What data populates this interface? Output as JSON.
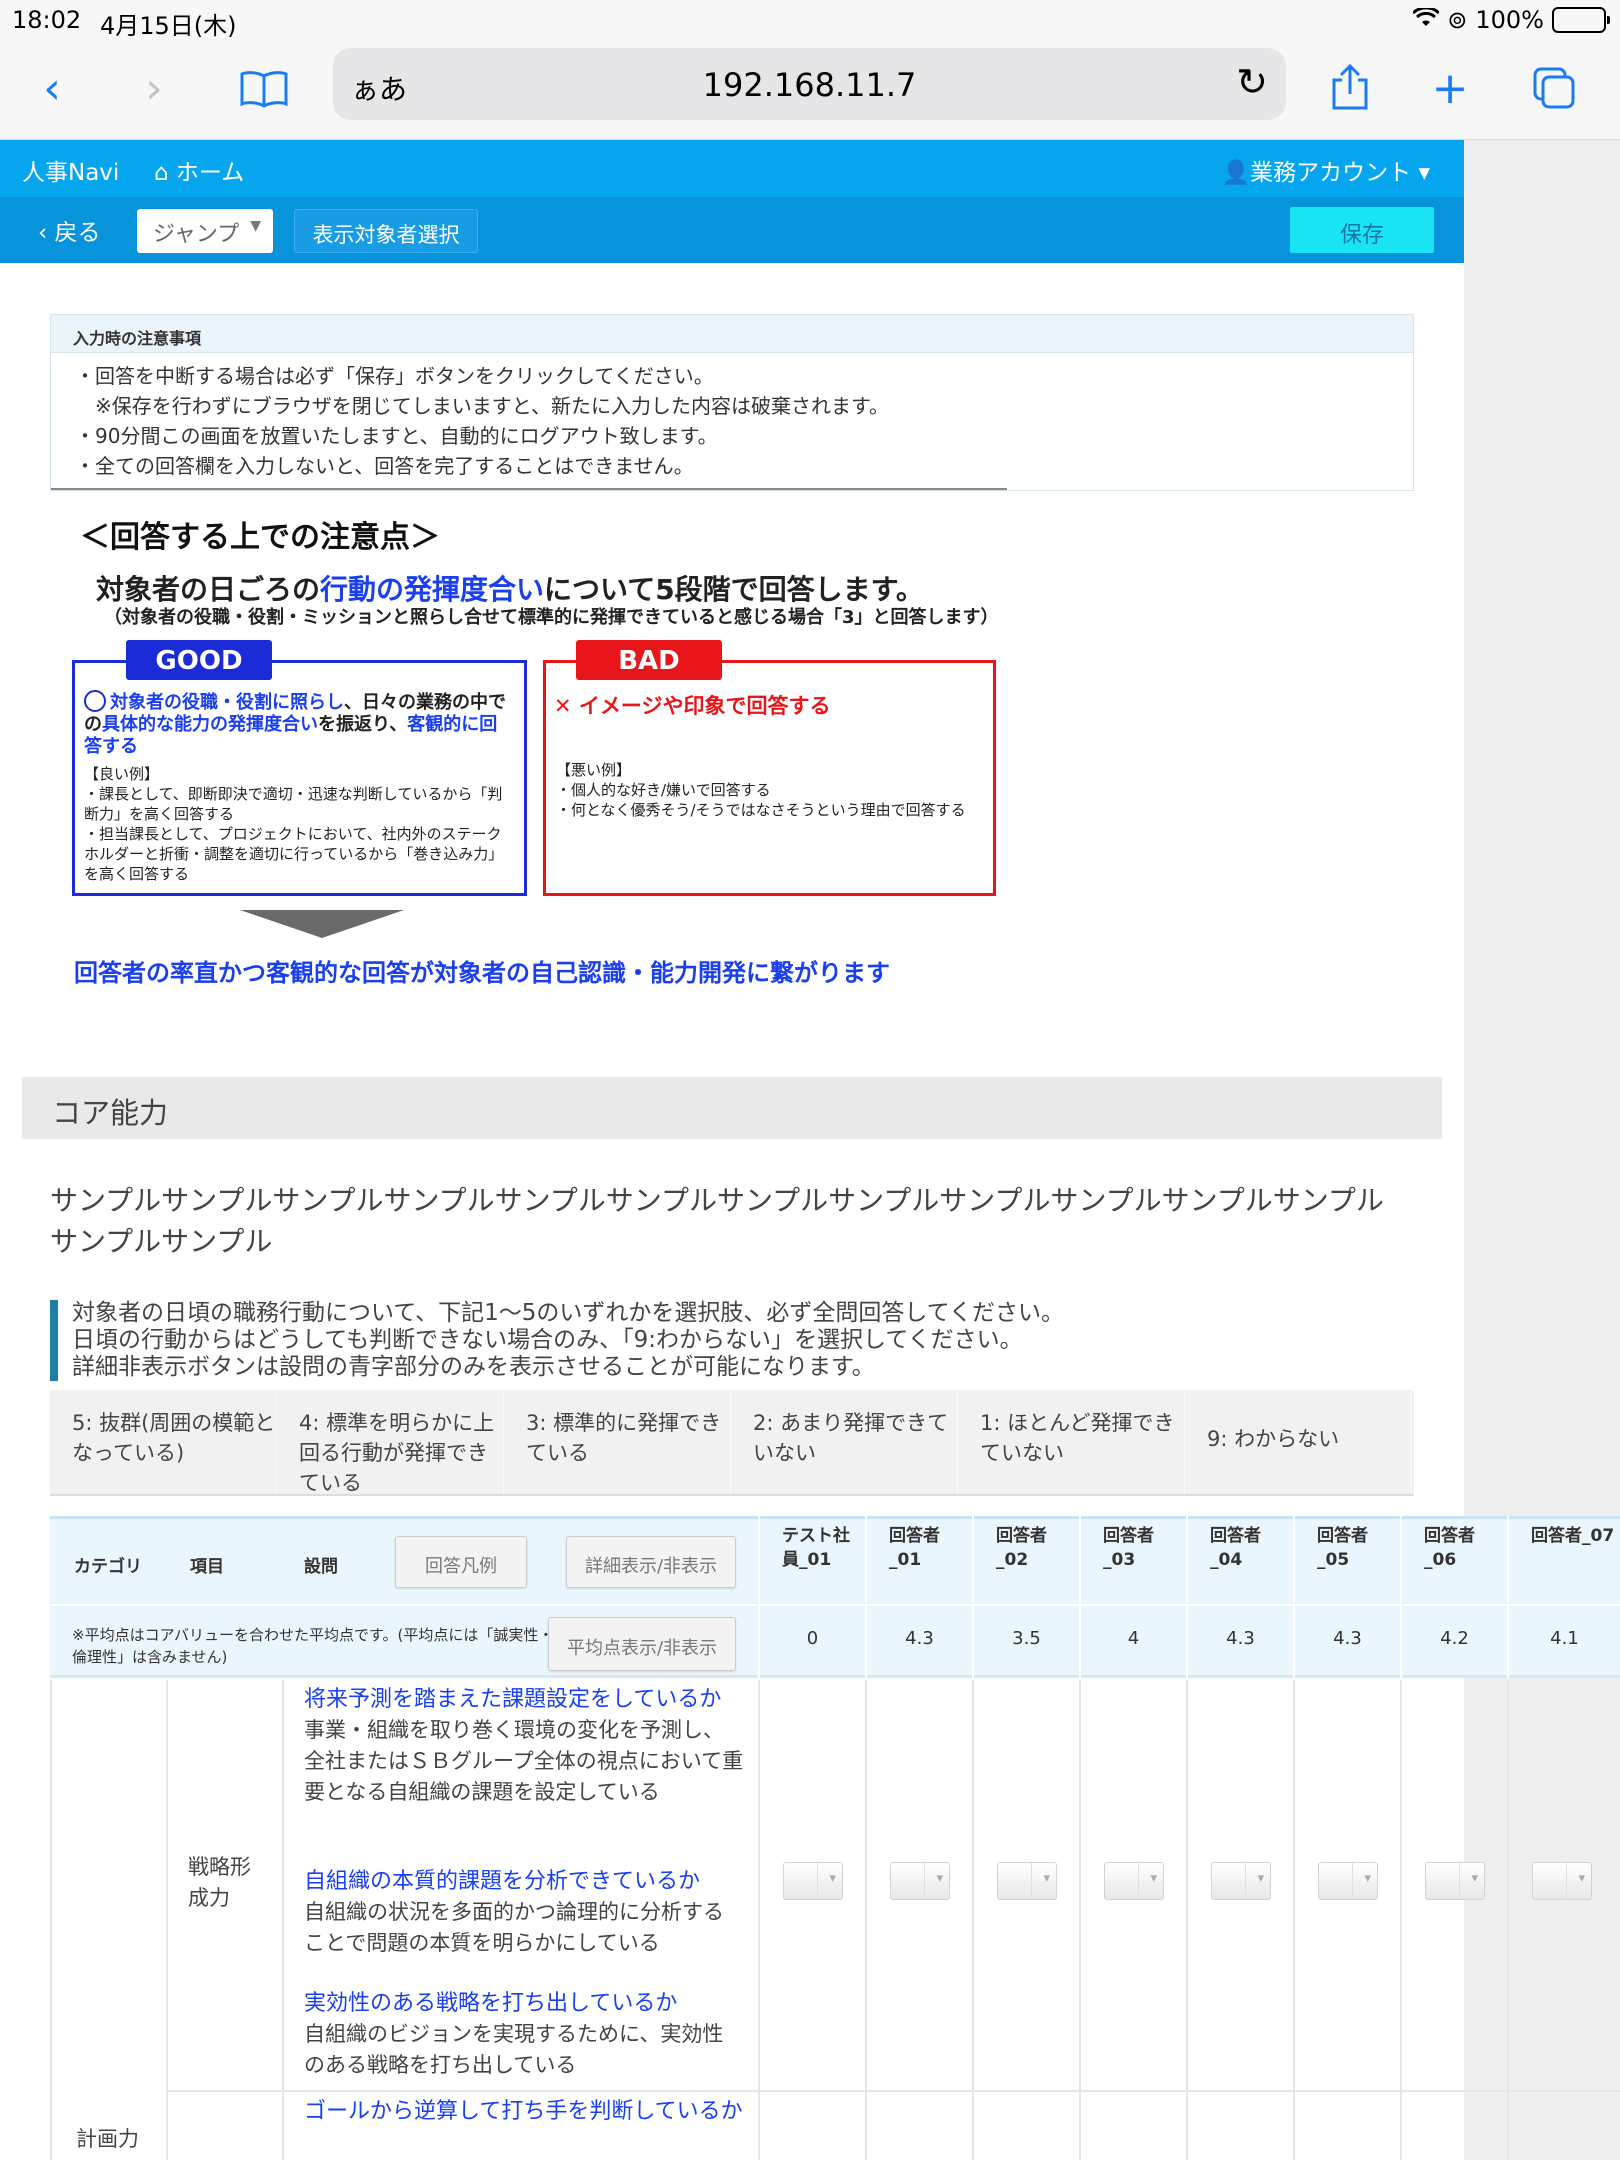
{
  "status_bar": {
    "time": "18:02",
    "date": "4月15日(木)",
    "battery": "100%"
  },
  "browser": {
    "aa_label": "ぁあ",
    "url": "192.168.11.7"
  },
  "app": {
    "brand": "人事Navi",
    "home": "ホーム",
    "account": "業務アカウント",
    "back": "戻る",
    "jump": "ジャンプ",
    "target_select": "表示対象者選択",
    "save": "保存"
  },
  "notice": {
    "title": "入力時の注意事項",
    "lines": [
      "・回答を中断する場合は必ず「保存」ボタンをクリックしてください。",
      "※保存を行わずにブラウザを閉じてしまいますと、新たに入力した内容は破棄されます。",
      "・90分間この画面を放置いたしますと、自動的にログアウト致します。",
      "・全ての回答欄を入力しないと、回答を完了することはできません。"
    ]
  },
  "points": {
    "title": "＜回答する上での注意点＞",
    "lead_pre": "対象者の日ごろの",
    "lead_blue": "行動の発揮度合い",
    "lead_post": "について5段階で回答します。",
    "sub": "（対象者の役職・役割・ミッションと照らし合せて標準的に発揮できていると感じる場合「3」と回答します）",
    "good_tag": "GOOD",
    "good_a": "対象者の役職・役割に照らし",
    "good_b": "、日々の業務の中での",
    "good_c": "具体的な能力の発揮度合い",
    "good_d": "を振返り、",
    "good_e": "客観的に回答する",
    "good_ex_title": "【良い例】",
    "good_ex_1": "・課長として、即断即決で適切・迅速な判断しているから「判断力」を高く回答する",
    "good_ex_2": "・担当課長として、プロジェクトにおいて、社内外のステークホルダーと折衝・調整を適切に行っているから「巻き込み力」を高く回答する",
    "bad_tag": "BAD",
    "bad_main": "イメージや印象で回答する",
    "bad_ex_title": "【悪い例】",
    "bad_ex_1": "・個人的な好き/嫌いで回答する",
    "bad_ex_2": "・何となく優秀そう/そうではなさそうという理由で回答する",
    "conclusion": "回答者の率直かつ客観的な回答が対象者の自己認識・能力開発に繋がります"
  },
  "section": {
    "title": "コア能力",
    "sample": "サンプルサンプルサンプルサンプルサンプルサンプルサンプルサンプルサンプルサンプルサンプルサンプルサンプルサンプル",
    "instr_1": "対象者の日頃の職務行動について、下記1〜5のいずれかを選択肢、必ず全問回答してください。",
    "instr_2": "日頃の行動からはどうしても判断できない場合のみ、「9:わからない」を選択してください。",
    "instr_3": "詳細非表示ボタンは設問の青字部分のみを表示させることが可能になります。"
  },
  "scale": [
    "5: 抜群(周囲の模範となっている)",
    "4: 標準を明らかに上回る行動が発揮できている",
    "3: 標準的に発揮できている",
    "2: あまり発揮できていない",
    "1: ほとんど発揮できていない",
    "9: わからない"
  ],
  "table": {
    "col_category": "カテゴリ",
    "col_item": "項目",
    "col_question": "設問",
    "legend_button": "回答凡例",
    "detail_button": "詳細表示/非表示",
    "avg_note": "※平均点はコアバリューを合わせた平均点です。(平均点には「誠実性・倫理性」は含みません)",
    "avg_button": "平均点表示/非表示",
    "respondents": [
      {
        "name": "テスト社員_01",
        "avg": "0"
      },
      {
        "name": "回答者_01",
        "avg": "4.3"
      },
      {
        "name": "回答者_02",
        "avg": "3.5"
      },
      {
        "name": "回答者_03",
        "avg": "4"
      },
      {
        "name": "回答者_04",
        "avg": "4.3"
      },
      {
        "name": "回答者_05",
        "avg": "4.3"
      },
      {
        "name": "回答者_06",
        "avg": "4.2"
      },
      {
        "name": "回答者_07",
        "avg": "4.1"
      }
    ],
    "category": "計画力",
    "item": "戦略形成力",
    "questions": [
      {
        "title": "将来予測を踏まえた課題設定をしているか",
        "desc": "事業・組織を取り巻く環境の変化を予測し、全社またはＳＢグループ全体の視点において重要となる自組織の課題を設定している"
      },
      {
        "title": "自組織の本質的課題を分析できているか",
        "desc": "自組織の状況を多面的かつ論理的に分析することで問題の本質を明らかにしている"
      },
      {
        "title": "実効性のある戦略を打ち出しているか",
        "desc": "自組織のビジョンを実現するために、実効性のある戦略を打ち出している"
      },
      {
        "title": "ゴールから逆算して打ち手を判断しているか",
        "desc": ""
      }
    ]
  }
}
